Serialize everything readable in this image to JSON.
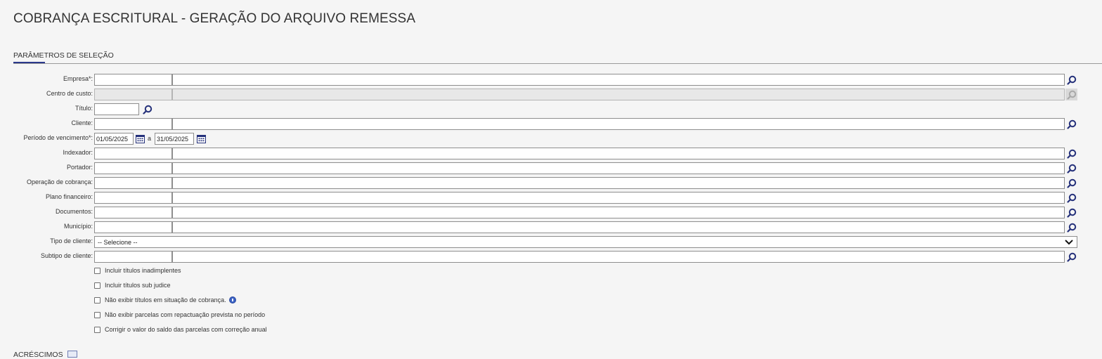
{
  "page": {
    "title": "COBRANÇA ESCRITURAL - GERAÇÃO DO ARQUIVO REMESSA"
  },
  "section": {
    "tab_label": "PARÂMETROS DE SELEÇÃO",
    "next_section_label": "ACRÉSCIMOS"
  },
  "form": {
    "empresa_label": "Empresa*:",
    "centro_custo_label": "Centro de custo:",
    "titulo_label": "Título:",
    "cliente_label": "Cliente:",
    "periodo_label": "Período de vencimento*:",
    "periodo_start": "01/05/2025",
    "periodo_sep": "a",
    "periodo_end": "31/05/2025",
    "indexador_label": "Indexador:",
    "portador_label": "Portador:",
    "operacao_label": "Operação de cobrança:",
    "plano_label": "Plano financeiro:",
    "documentos_label": "Documentos:",
    "municipio_label": "Município:",
    "tipo_cliente_label": "Tipo de cliente:",
    "tipo_cliente_value": "-- Selecione --",
    "subtipo_label": "Subtipo de cliente:"
  },
  "checkboxes": [
    {
      "label": "Incluir títulos inadimplentes",
      "checked": false
    },
    {
      "label": "Incluir títulos sub judice",
      "checked": false
    },
    {
      "label": "Não exibir títulos em situação de cobrança.",
      "checked": false
    },
    {
      "label": "Não exibir parcelas com repactuação prevista no período",
      "checked": false
    },
    {
      "label": "Corrigir o valor do saldo das parcelas com correção anual",
      "checked": false
    }
  ],
  "icons": {
    "lookup": "search-icon",
    "calendar": "calendar-icon",
    "info": "info-icon",
    "dropdown": "chevron-down-icon",
    "collapse": "collapse-icon"
  },
  "colors": {
    "accent": "#2c3a8c",
    "icon_blue": "#24307a",
    "background": "#f5f5f5"
  }
}
